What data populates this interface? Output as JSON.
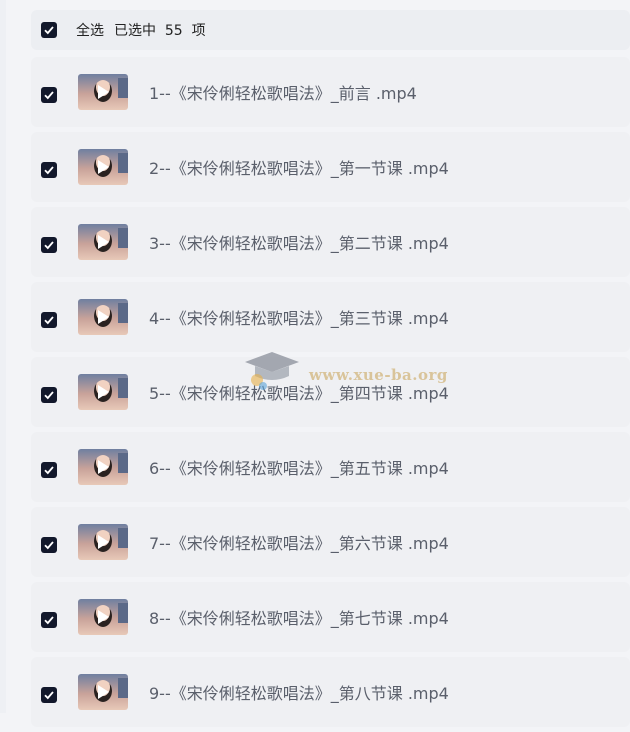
{
  "header": {
    "select_all_label": "全选",
    "selected_text": "已选中  55  项"
  },
  "files": [
    {
      "name": "1--《宋伶俐轻松歌唱法》_前言 .mp4",
      "checked": true
    },
    {
      "name": "2--《宋伶俐轻松歌唱法》_第一节课 .mp4",
      "checked": true
    },
    {
      "name": "3--《宋伶俐轻松歌唱法》_第二节课 .mp4",
      "checked": true
    },
    {
      "name": "4--《宋伶俐轻松歌唱法》_第三节课 .mp4",
      "checked": true
    },
    {
      "name": "5--《宋伶俐轻松歌唱法》_第四节课 .mp4",
      "checked": true
    },
    {
      "name": "6--《宋伶俐轻松歌唱法》_第五节课 .mp4",
      "checked": true
    },
    {
      "name": "7--《宋伶俐轻松歌唱法》_第六节课 .mp4",
      "checked": true
    },
    {
      "name": "8--《宋伶俐轻松歌唱法》_第七节课 .mp4",
      "checked": true
    },
    {
      "name": "9--《宋伶俐轻松歌唱法》_第八节课 .mp4",
      "checked": true
    }
  ],
  "watermark": {
    "text": "www.xue-ba.org"
  },
  "colors": {
    "checkbox": "#12182b",
    "row_bg": "#eff0f3",
    "text": "#5a5f6b"
  }
}
